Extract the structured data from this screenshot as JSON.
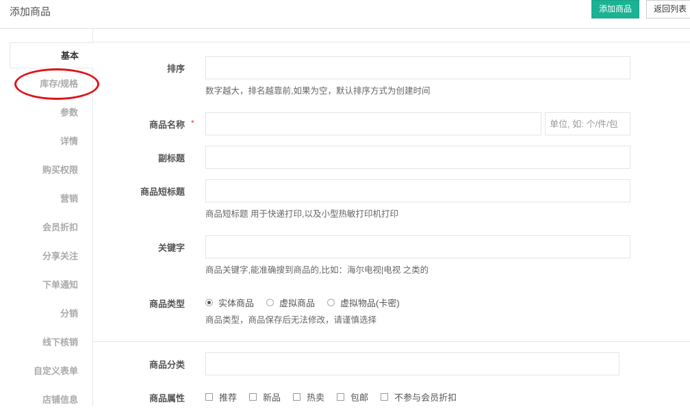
{
  "header": {
    "title": "添加商品",
    "add_button": "添加商品",
    "back_button": "返回列表"
  },
  "sidebar": {
    "items": [
      {
        "label": "基本",
        "active": true
      },
      {
        "label": "库存/规格",
        "active": false
      },
      {
        "label": "参数",
        "active": false
      },
      {
        "label": "详情",
        "active": false
      },
      {
        "label": "购买权限",
        "active": false
      },
      {
        "label": "营销",
        "active": false
      },
      {
        "label": "会员折扣",
        "active": false
      },
      {
        "label": "分享关注",
        "active": false
      },
      {
        "label": "下单通知",
        "active": false
      },
      {
        "label": "分销",
        "active": false
      },
      {
        "label": "线下核销",
        "active": false
      },
      {
        "label": "自定义表单",
        "active": false
      },
      {
        "label": "店铺信息",
        "active": false
      }
    ],
    "highlight_color": "#e0121a"
  },
  "form": {
    "sort": {
      "label": "排序",
      "value": "",
      "help": "数字越大，排名越靠前,如果为空，默认排序方式为创建时间"
    },
    "name": {
      "label": "商品名称",
      "required_mark": "*",
      "value": "",
      "unit_placeholder": "单位, 如: 个/件/包"
    },
    "subtitle": {
      "label": "副标题",
      "value": ""
    },
    "short_title": {
      "label": "商品短标题",
      "value": "",
      "help": "商品短标题 用于快递打印,以及小型热敏打印机打印"
    },
    "keywords": {
      "label": "关键字",
      "value": "",
      "help": "商品关键字,能准确搜到商品的,比如：海尔电视|电视 之类的"
    },
    "type": {
      "label": "商品类型",
      "options": [
        "实体商品",
        "虚拟商品",
        "虚拟物品(卡密)"
      ],
      "selected": "实体商品",
      "help": "商品类型，商品保存后无法修改，请谨慎选择"
    },
    "category": {
      "label": "商品分类",
      "value": ""
    },
    "attributes": {
      "label": "商品属性",
      "options": [
        "推荐",
        "新品",
        "热卖",
        "包邮",
        "不参与会员折扣"
      ]
    }
  },
  "colors": {
    "primary": "#1ab394",
    "required": "#e33333"
  }
}
